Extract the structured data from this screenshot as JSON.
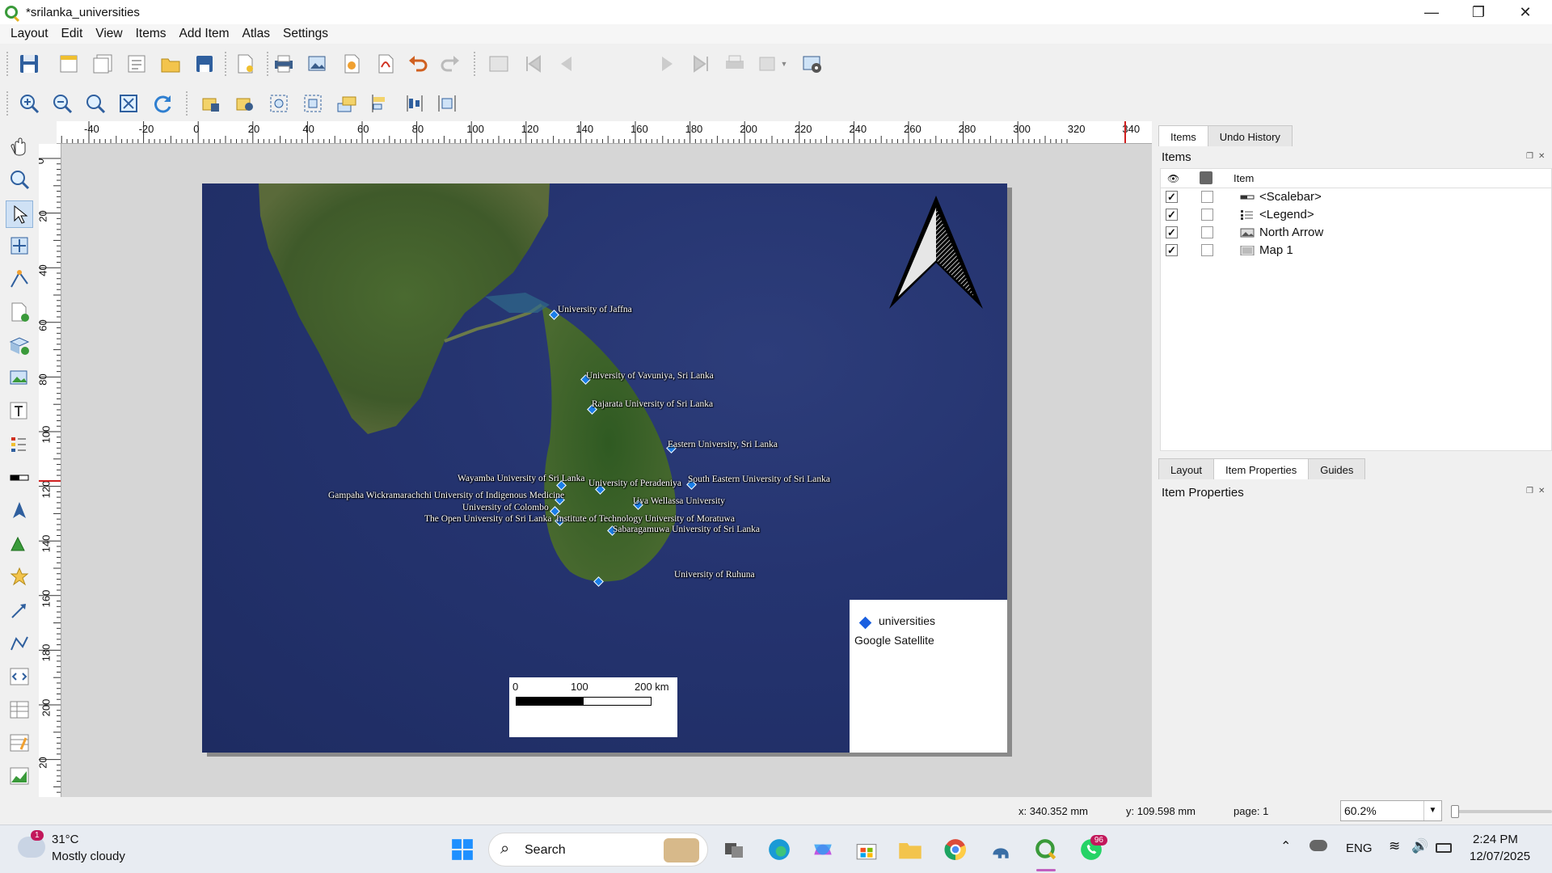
{
  "window": {
    "title": "*srilanka_universities",
    "minimize": "—",
    "restore": "❐",
    "close": "✕"
  },
  "menu": [
    "Layout",
    "Edit",
    "View",
    "Items",
    "Add Item",
    "Atlas",
    "Settings"
  ],
  "toolbar": {
    "page_number": "1"
  },
  "ruler": {
    "h_ticks": [
      "-40",
      "-20",
      "0",
      "20",
      "40",
      "60",
      "80",
      "100",
      "120",
      "140",
      "160",
      "180",
      "200",
      "220",
      "240",
      "260",
      "280",
      "300",
      "320",
      "340"
    ],
    "v_ticks": [
      "0",
      "20",
      "40",
      "60",
      "80",
      "100",
      "120",
      "140",
      "160",
      "180",
      "200",
      "20"
    ]
  },
  "map": {
    "universities": [
      {
        "name": "University of Jaffna"
      },
      {
        "name": "University of Vavuniya, Sri Lanka"
      },
      {
        "name": "Rajarata University of Sri Lanka"
      },
      {
        "name": "Eastern University, Sri Lanka"
      },
      {
        "name": "Wayamba University of Sri Lanka"
      },
      {
        "name": "University of Peradeniya"
      },
      {
        "name": "South Eastern University of Sri Lanka"
      },
      {
        "name": "Gampaha Wickramarachchi University of Indigenous Medicine"
      },
      {
        "name": "Uva Wellassa University"
      },
      {
        "name": "University of Colombo"
      },
      {
        "name": "The Open University of Sri Lanka"
      },
      {
        "name": "Institute of Technology University of Moratuwa"
      },
      {
        "name": "Sabaragamuwa University of Sri Lanka"
      },
      {
        "name": "University of Ruhuna"
      }
    ],
    "legend": {
      "layer1": "universities",
      "layer2": "Google Satellite"
    },
    "scalebar": {
      "t0": "0",
      "t1": "100",
      "t2": "200 km"
    }
  },
  "panel": {
    "top_tabs": [
      "Items",
      "Undo History"
    ],
    "items_title": "Items",
    "col_item": "Item",
    "items": [
      {
        "label": "<Scalebar>",
        "checked": "✓"
      },
      {
        "label": "<Legend>",
        "checked": "✓"
      },
      {
        "label": "North Arrow",
        "checked": "✓"
      },
      {
        "label": "Map 1",
        "checked": "✓"
      }
    ],
    "bottom_tabs": [
      "Layout",
      "Item Properties",
      "Guides"
    ],
    "props_title": "Item Properties"
  },
  "status": {
    "x": "x: 340.352 mm",
    "y": "y: 109.598 mm",
    "page": "page: 1",
    "zoom": "60.2%"
  },
  "taskbar": {
    "temp": "31°C",
    "weather": "Mostly cloudy",
    "weather_badge": "1",
    "search": "Search",
    "lang": "ENG",
    "time": "2:24 PM",
    "date": "12/07/2025",
    "whatsapp_badge": "96"
  },
  "colors": {
    "accent": "#3a9a3a",
    "ocean": "#253470",
    "land": "#3f5a2a",
    "point": "#1a7ee8"
  }
}
